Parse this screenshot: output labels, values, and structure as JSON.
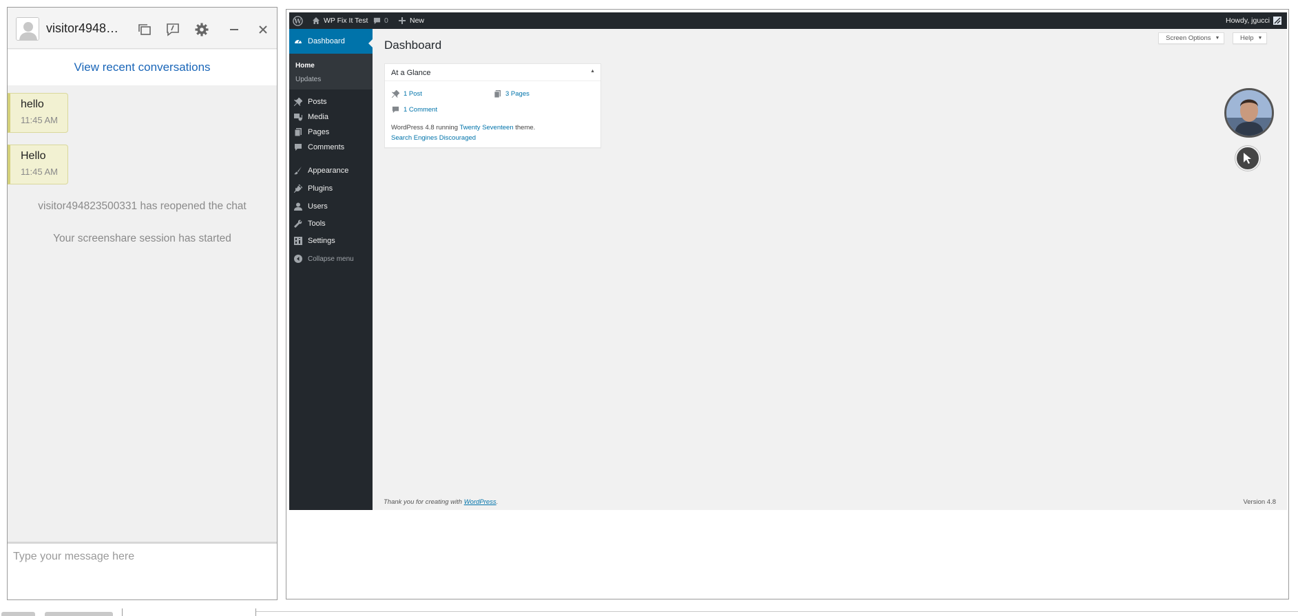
{
  "chat": {
    "title": "visitor49482…",
    "recent_link": "View recent conversations",
    "messages": [
      {
        "text": "hello",
        "time": "11:45 AM"
      },
      {
        "text": "Hello",
        "time": "11:45 AM"
      }
    ],
    "system_messages": [
      "visitor494823500331 has reopened the chat",
      "Your screenshare session has started"
    ],
    "input_placeholder": "Type your message here",
    "header_icons": [
      "transfer-icon",
      "end-chat-icon",
      "gear-icon",
      "minimize-icon",
      "close-icon"
    ]
  },
  "wp": {
    "adminbar": {
      "site_name": "WP Fix It Test",
      "comments_count": "0",
      "new_label": "New",
      "howdy": "Howdy, jgucci"
    },
    "menu": {
      "dashboard": "Dashboard",
      "home": "Home",
      "updates": "Updates",
      "posts": "Posts",
      "media": "Media",
      "pages": "Pages",
      "comments": "Comments",
      "appearance": "Appearance",
      "plugins": "Plugins",
      "users": "Users",
      "tools": "Tools",
      "settings": "Settings",
      "collapse": "Collapse menu"
    },
    "page_title": "Dashboard",
    "screen_options": "Screen Options",
    "help": "Help",
    "glance": {
      "title": "At a Glance",
      "posts": "1 Post",
      "pages": "3 Pages",
      "comments": "1 Comment",
      "running_prefix": "WordPress 4.8 running ",
      "theme": "Twenty Seventeen",
      "running_suffix": " theme.",
      "search_engines": "Search Engines Discouraged"
    },
    "footer": {
      "thanks_prefix": "Thank you for creating with ",
      "wordpress_link": "WordPress",
      "thanks_suffix": ".",
      "version": "Version 4.8"
    }
  },
  "colors": {
    "link_blue": "#1a66b8",
    "wp_dark": "#23282d",
    "wp_blue": "#0073aa",
    "bubble": "#f2f1d2"
  }
}
